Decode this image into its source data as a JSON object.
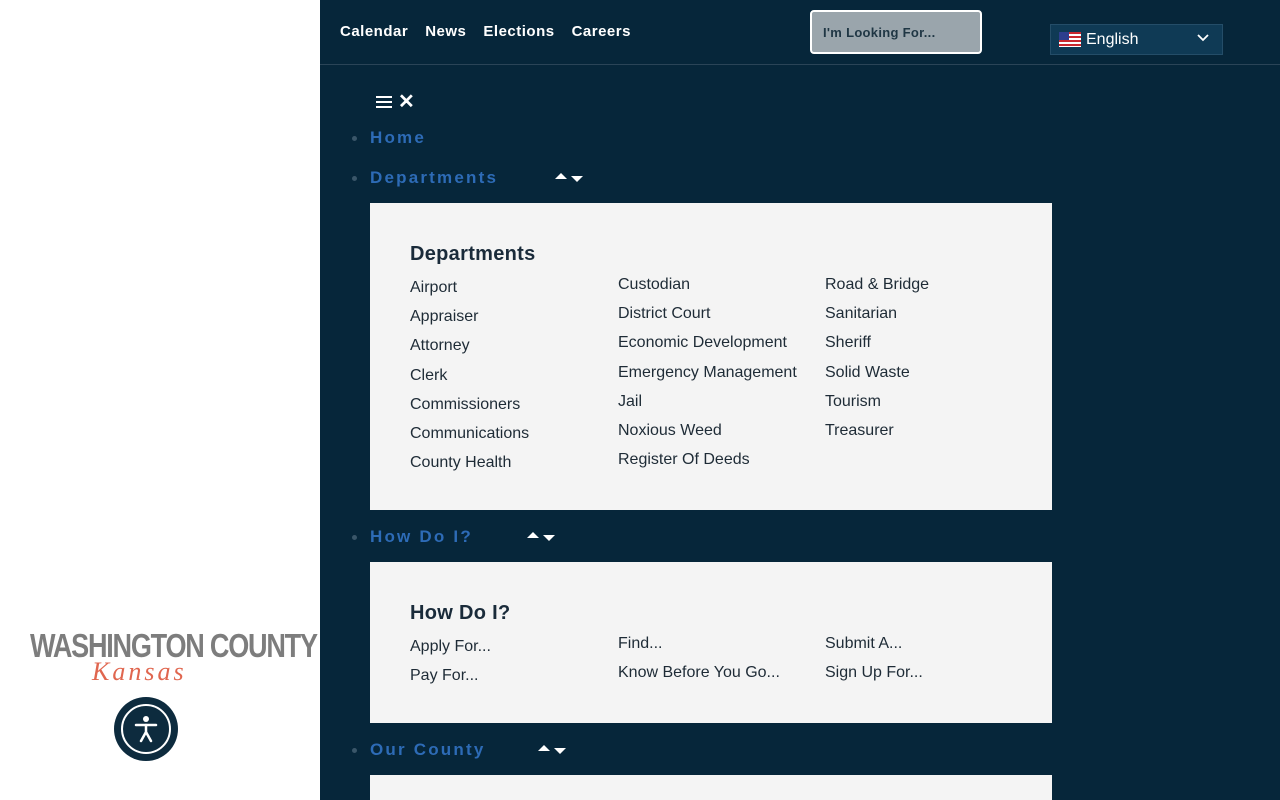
{
  "header": {
    "links": [
      "Calendar",
      "News",
      "Elections",
      "Careers"
    ],
    "search_placeholder": "I'm Looking For...",
    "language": "English"
  },
  "logo": {
    "line1": "WASHINGTON COUNTY",
    "line2": "Kansas"
  },
  "nav": {
    "home": "Home",
    "departments": "Departments",
    "how_do_i": "How Do I?",
    "our_county": "Our County"
  },
  "departments_panel": {
    "title": "Departments",
    "col1": [
      "Airport",
      "Appraiser",
      "Attorney",
      "Clerk",
      "Commissioners",
      "Communications",
      "County Health"
    ],
    "col2": [
      "Custodian",
      "District Court",
      "Economic Development",
      "Emergency Management",
      "Jail",
      "Noxious Weed",
      "Register Of Deeds"
    ],
    "col3": [
      "Road & Bridge",
      "Sanitarian",
      "Sheriff",
      "Solid Waste",
      "Tourism",
      "Treasurer"
    ]
  },
  "howdoi_panel": {
    "title": "How Do I?",
    "col1": [
      "Apply For...",
      "Pay For..."
    ],
    "col2": [
      "Find...",
      "Know Before You Go..."
    ],
    "col3": [
      "Submit A...",
      "Sign Up For..."
    ]
  },
  "colors": {
    "dark_bg": "#06263a",
    "nav_blue": "#2d6bb6",
    "logo_gray": "#7d7d7d",
    "logo_orange": "#e0664f",
    "panel_bg": "#f4f4f4"
  }
}
